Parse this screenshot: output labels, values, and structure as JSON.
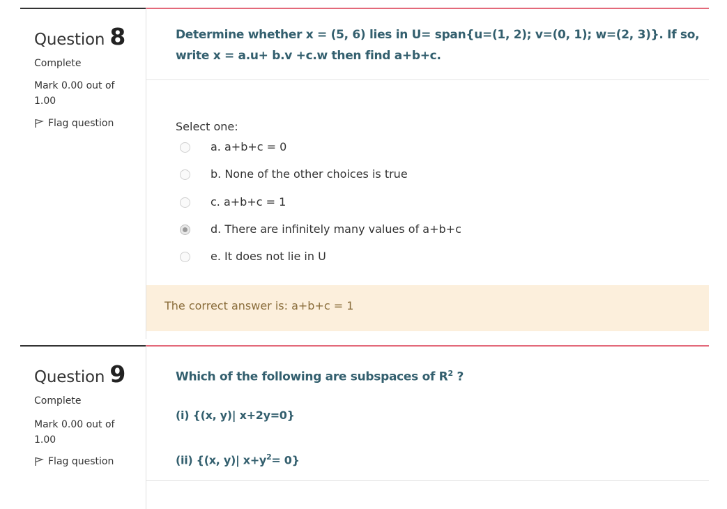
{
  "questions": [
    {
      "label": "Question",
      "number": "8",
      "state": "Complete",
      "mark": "Mark 0.00 out of 1.00",
      "flag_label": "Flag question",
      "text_line1": "Determine whether x = (5, 6) lies in U= span{u=(1, 2); v=(0, 1); w=(2, 3)}. If so,",
      "text_line2": "write x = a.u+ b.v +c.w then find a+b+c.",
      "prompt": "Select one:",
      "options": [
        {
          "label": "a. a+b+c = 0",
          "selected": false
        },
        {
          "label": "b. None of the other choices is true",
          "selected": false
        },
        {
          "label": "c. a+b+c = 1",
          "selected": false
        },
        {
          "label": "d. There are infinitely many values of a+b+c",
          "selected": true
        },
        {
          "label": "e. It does not lie in U",
          "selected": false
        }
      ],
      "feedback": "The correct answer is: a+b+c = 1"
    },
    {
      "label": "Question",
      "number": "9",
      "state": "Complete",
      "mark": "Mark 0.00 out of 1.00",
      "flag_label": "Flag question",
      "text_main": "Which of the following are subspaces of R",
      "text_sup": "2",
      "text_end": " ?",
      "item1": "(i) {(x, y)| x+2y=0}",
      "item2_pre": "(ii) {(x, y)| x+y",
      "item2_sup": "2",
      "item2_post": "= 0}"
    }
  ],
  "colors": {
    "question_text": "#335f6e",
    "accent_border": "#e3697a",
    "feedback_bg": "#fcefdc",
    "feedback_text": "#8a6d3b"
  }
}
